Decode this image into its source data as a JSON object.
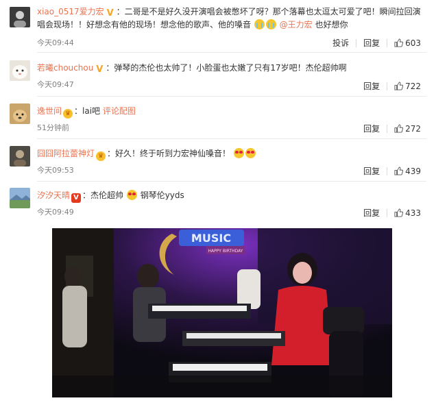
{
  "comments": [
    {
      "username": "xiao_0517爱力宏",
      "badge": "V",
      "text_a": "：二哥是不是好久没开演唱会被憋坏了呀？那个落幕也太逗太可爱了吧！瞬间拉回演唱会现场！！好想念有他的现场！想念他的歌声、他的嗓音",
      "mention": "@王力宏",
      "text_b": "也好想你",
      "time": "今天09:44",
      "report": "投诉",
      "reply": "回复",
      "likes": "603"
    },
    {
      "username": "若曦chouchou",
      "badge": "V",
      "text": "：弹琴的杰伦也太帅了！小脸蛋也太嫩了只有17岁吧！杰伦超帅啊",
      "time": "今天09:47",
      "reply": "回复",
      "likes": "722"
    },
    {
      "username": "逸世间",
      "text": "：lai吧",
      "link": "评论配图",
      "time": "51分钟前",
      "reply": "回复",
      "likes": "272"
    },
    {
      "username": "囧囧阿拉蕾神灯",
      "text": "：好久！终于听到力宏神仙嗓音！",
      "time": "今天09:53",
      "reply": "回复",
      "likes": "439"
    },
    {
      "username": "汐汐天晴",
      "badge": "V",
      "text_a": "：杰伦超帅",
      "text_b": "钢琴伦yyds",
      "time": "今天09:49",
      "reply": "回复",
      "likes": "433"
    }
  ],
  "video": {
    "sign_text": "MUSIC",
    "sign_sub": "HAPPY BIRTHDAY"
  },
  "colors": {
    "username": "#eb7350",
    "time": "#808080",
    "badge_gold": "#f5a623",
    "badge_red": "#e43a20"
  }
}
